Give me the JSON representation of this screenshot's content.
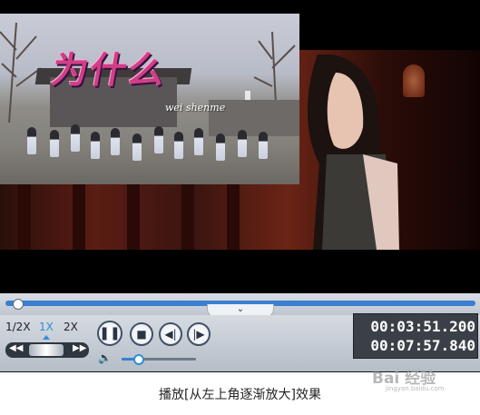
{
  "video": {
    "overlay_title": "为什么",
    "overlay_subtitle": "wei shenme"
  },
  "seek": {
    "progress": 0.0256,
    "collapse_icon": "chevron-down-icon",
    "collapse_glyph": "⌄"
  },
  "speed": {
    "options": [
      "1/2X",
      "1X",
      "2X"
    ],
    "selected": "1X"
  },
  "jog": {
    "rewind_glyph": "◀◀",
    "forward_glyph": "▶▶"
  },
  "buttons": {
    "play_pause_glyph": "❚❚",
    "stop_glyph": "■",
    "prev_glyph": "◀|",
    "next_glyph": "|▶"
  },
  "volume": {
    "icon_glyph": "🔈",
    "level": 0.22
  },
  "time": {
    "current": "00:03:51.200",
    "total": "00:07:57.840"
  },
  "caption": "播放[从左上角逐渐放大]效果",
  "watermark": {
    "logo": "Bai 经验",
    "url": "jingyan.baidu.com"
  },
  "colors": {
    "accent": "#3b7fd1",
    "speed_active": "#2e8fd6",
    "time_bg": "#3b4048",
    "title_art": "#d03f86"
  }
}
